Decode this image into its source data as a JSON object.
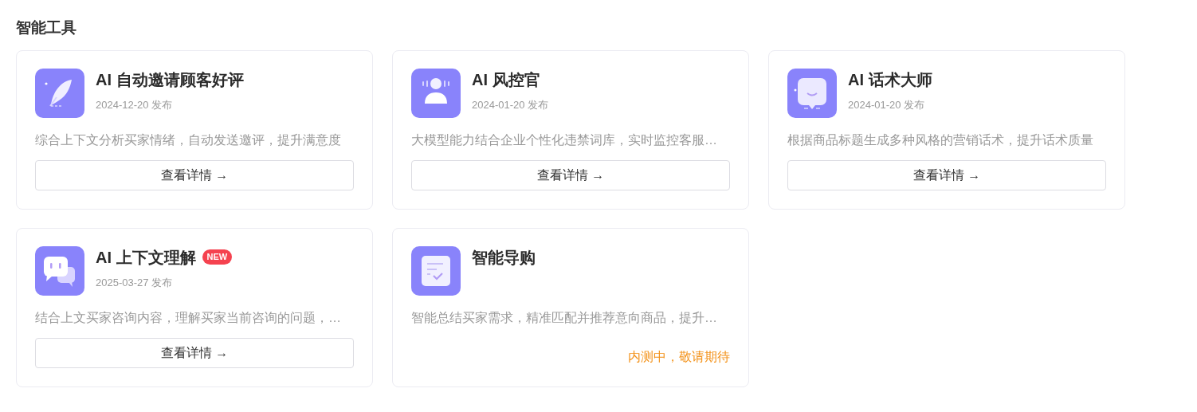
{
  "section_title": "智能工具",
  "tools": [
    {
      "title": "AI 自动邀请顾客好评",
      "date": "2024-12-20 发布",
      "description": "综合上下文分析买家情绪，自动发送邀评，提升满意度",
      "action": {
        "kind": "button",
        "label": "查看详情 →"
      }
    },
    {
      "title": "AI 风控官",
      "date": "2024-01-20 发布",
      "description": "大模型能力结合企业个性化违禁词库，实时监控客服…",
      "action": {
        "kind": "button",
        "label": "查看详情 →"
      }
    },
    {
      "title": "AI 话术大师",
      "date": "2024-01-20 发布",
      "description": "根据商品标题生成多种风格的营销话术，提升话术质量",
      "action": {
        "kind": "button",
        "label": "查看详情 →"
      }
    },
    {
      "title": "AI 上下文理解",
      "badge": "NEW",
      "date": "2025-03-27 发布",
      "description": "结合上文买家咨询内容，理解买家当前咨询的问题，…",
      "action": {
        "kind": "button",
        "label": "查看详情 →"
      }
    },
    {
      "title": "智能导购",
      "description": "智能总结买家需求，精准匹配并推荐意向商品，提升…",
      "action": {
        "kind": "status",
        "label": "内测中，敬请期待"
      }
    }
  ]
}
